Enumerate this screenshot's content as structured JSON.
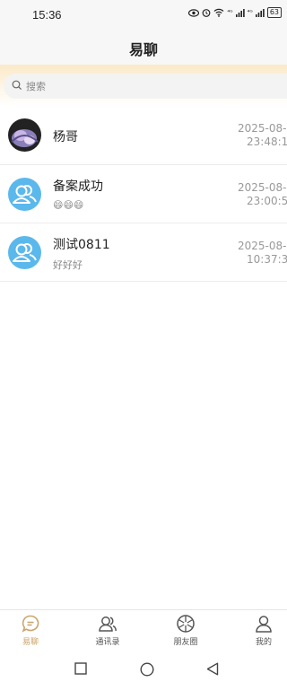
{
  "status": {
    "time": "15:36",
    "battery": "63",
    "signal1": "⁴ᴳ",
    "signal2": "⁴ᴳ"
  },
  "header": {
    "title": "易聊"
  },
  "search": {
    "placeholder": "搜索"
  },
  "conversations": [
    {
      "name": "杨哥",
      "message": "",
      "date": "2025-08-",
      "time": "23:48:1",
      "avatar": "photo"
    },
    {
      "name": "备案成功",
      "message": "😄😄😄",
      "date": "2025-08-",
      "time": "23:00:5",
      "avatar": "person-icon"
    },
    {
      "name": "测试0811",
      "message": "好好好",
      "date": "2025-08-",
      "time": "10:37:3",
      "avatar": "person-icon"
    }
  ],
  "tabs": [
    {
      "label": "易聊",
      "icon": "chat-bubble-icon",
      "active": true
    },
    {
      "label": "通讯录",
      "icon": "contacts-icon",
      "active": false
    },
    {
      "label": "朋友圈",
      "icon": "moments-icon",
      "active": false
    },
    {
      "label": "我的",
      "icon": "profile-icon",
      "active": false
    }
  ],
  "colors": {
    "accent": "#c9a46a",
    "avatar_blue": "#5bb8ec",
    "search_gradient": "#fbe9c8"
  }
}
